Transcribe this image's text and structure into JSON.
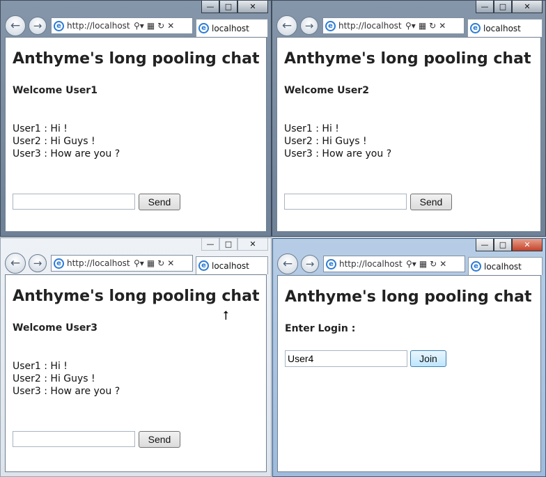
{
  "windows": [
    {
      "title": "Anthyme's long pooling chat",
      "tab_label": "localhost",
      "url": "http://localhost",
      "welcome": "Welcome User1",
      "messages": [
        "User1 : Hi !",
        "User2 : Hi Guys !",
        "User3 : How are you ?"
      ],
      "send_label": "Send"
    },
    {
      "title": "Anthyme's long pooling chat",
      "tab_label": "localhost",
      "url": "http://localhost",
      "welcome": "Welcome User2",
      "messages": [
        "User1 : Hi !",
        "User2 : Hi Guys !",
        "User3 : How are you ?"
      ],
      "send_label": "Send"
    },
    {
      "title": "Anthyme's long pooling chat",
      "tab_label": "localhost",
      "url": "http://localhost",
      "welcome": "Welcome User3",
      "messages": [
        "User1 : Hi !",
        "User2 : Hi Guys !",
        "User3 : How are you ?"
      ],
      "send_label": "Send"
    },
    {
      "title": "Anthyme's long pooling chat",
      "tab_label": "localhost",
      "url": "http://localhost",
      "login_label": "Enter Login :",
      "login_value": "User4",
      "join_label": "Join"
    }
  ],
  "icons": {
    "back": "back-arrow-icon",
    "forward": "forward-arrow-icon",
    "search": "search-icon",
    "compat": "compatibility-view-icon",
    "refresh": "refresh-icon",
    "stop": "stop-icon",
    "ie": "ie-logo-icon"
  },
  "colors": {
    "close_active": "#c2432a",
    "join_border": "#3c7fb1"
  }
}
